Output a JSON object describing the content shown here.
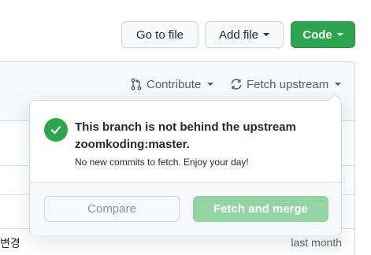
{
  "toolbar": {
    "go_to_file": "Go to file",
    "add_file": "Add file",
    "code": "Code"
  },
  "branch_actions": {
    "contribute": "Contribute",
    "fetch_upstream": "Fetch upstream"
  },
  "popover": {
    "title": "This branch is not behind the upstream zoomkoding:master.",
    "subtitle": "No new commits to fetch. Enjoy your day!",
    "compare_label": "Compare",
    "fetch_merge_label": "Fetch and merge"
  },
  "file_row": {
    "commit_text_fragment": "변경",
    "time": "last month"
  },
  "colors": {
    "primary_green": "#2da44e",
    "disabled_green": "#94d3a2"
  }
}
